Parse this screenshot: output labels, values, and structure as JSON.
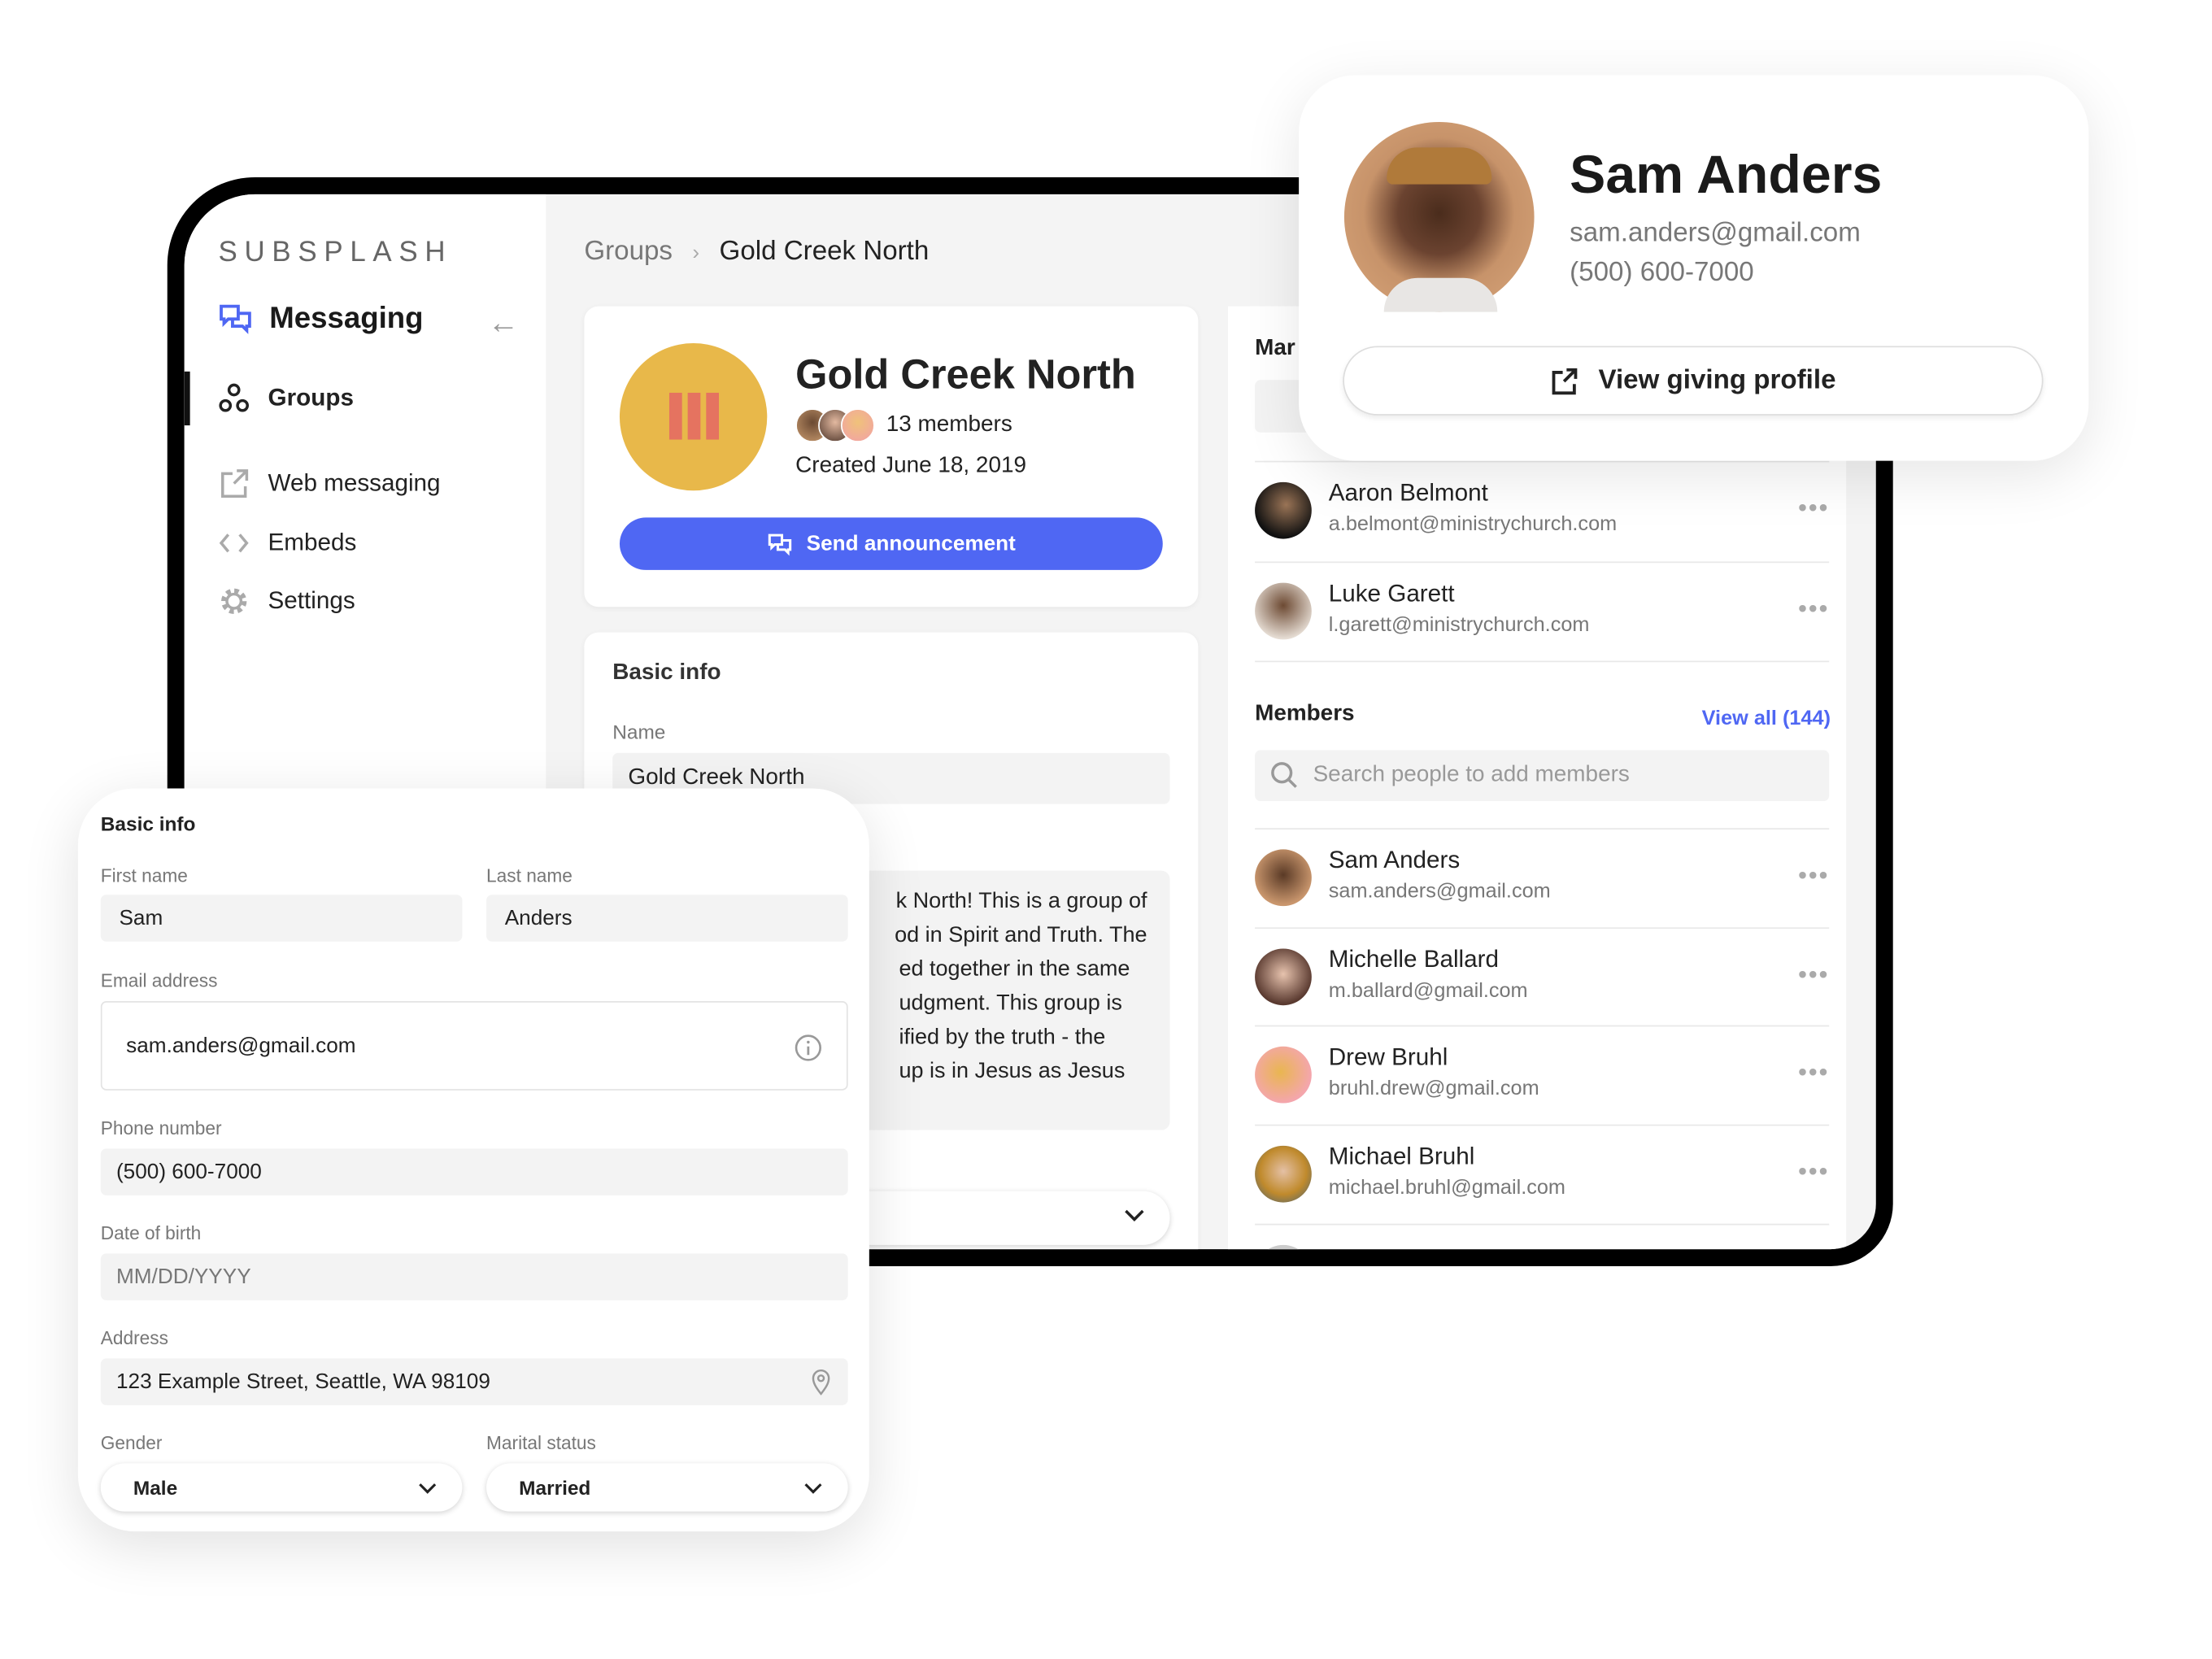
{
  "colors": {
    "accent": "#4f67f3",
    "group_avatar": "#e8b84a",
    "group_avatar_bars": "#e57360"
  },
  "sidebar": {
    "logo": "SUBSPLASH",
    "section_title": "Messaging",
    "items": [
      {
        "label": "Groups",
        "icon": "groups-icon",
        "active": true
      },
      {
        "label": "Web messaging",
        "icon": "external-link-icon"
      },
      {
        "label": "Embeds",
        "icon": "code-icon"
      },
      {
        "label": "Settings",
        "icon": "gear-icon"
      }
    ]
  },
  "breadcrumb": {
    "parent": "Groups",
    "current": "Gold Creek North"
  },
  "group": {
    "title": "Gold Creek North",
    "members": "13 members",
    "created": "Created June 18, 2019",
    "send_label": "Send announcement"
  },
  "basic_info": {
    "heading": "Basic info",
    "name_label": "Name",
    "name_value": "Gold Creek North",
    "description_lines": [
      "k North! This is a group of",
      "od in Spirit and Truth. The",
      "ed together in the same",
      "udgment. This group is",
      "ified by the truth - the",
      "up is in Jesus as Jesus"
    ]
  },
  "managers": {
    "heading_partial": "Mar",
    "rows": [
      {
        "name": "Aaron Belmont",
        "email": "a.belmont@ministrychurch.com"
      },
      {
        "name": "Luke Garett",
        "email": "l.garett@ministrychurch.com"
      }
    ]
  },
  "members": {
    "heading": "Members",
    "view_all": "View all (144)",
    "search_placeholder": "Search people to add members",
    "rows": [
      {
        "name": "Sam Anders",
        "email": "sam.anders@gmail.com"
      },
      {
        "name": "Michelle Ballard",
        "email": "m.ballard@gmail.com"
      },
      {
        "name": "Drew Bruhl",
        "email": "bruhl.drew@gmail.com"
      },
      {
        "name": "Michael Bruhl",
        "email": "michael.bruhl@gmail.com"
      }
    ]
  },
  "profile": {
    "name": "Sam Anders",
    "email": "sam.anders@gmail.com",
    "phone": "(500) 600-7000",
    "button": "View giving profile"
  },
  "person_form": {
    "heading": "Basic info",
    "first_name_label": "First name",
    "first_name": "Sam",
    "last_name_label": "Last name",
    "last_name": "Anders",
    "email_label": "Email address",
    "email": "sam.anders@gmail.com",
    "phone_label": "Phone number",
    "phone": "(500) 600-7000",
    "dob_label": "Date of birth",
    "dob_placeholder": "MM/DD/YYYY",
    "address_label": "Address",
    "address": "123 Example Street, Seattle, WA 98109",
    "gender_label": "Gender",
    "gender": "Male",
    "marital_label": "Marital status",
    "marital": "Married"
  }
}
